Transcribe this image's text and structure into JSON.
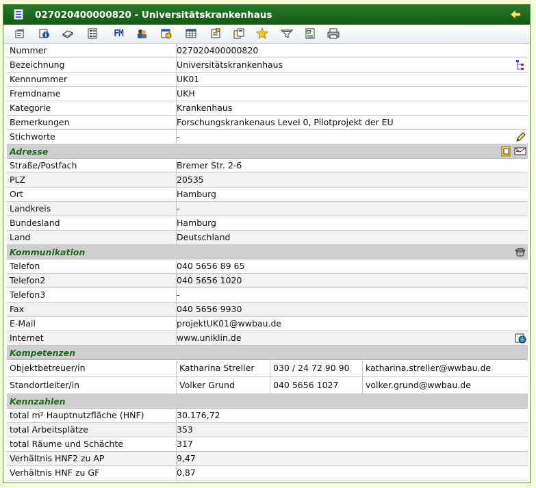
{
  "window": {
    "title": "027020400000820 - Universitätskrankenhaus"
  },
  "toolbar": {
    "buttons": [
      "properties-icon",
      "info-icon",
      "eraser-icon",
      "list-icon",
      "fm-icon",
      "users-icon",
      "calendar-icon",
      "table-icon",
      "notes-icon",
      "documents-icon",
      "favorite-star-icon",
      "filter-icon",
      "excel-export-icon",
      "print-icon"
    ],
    "fm_label": "FM"
  },
  "general": [
    {
      "label": "Nummer",
      "value": "027020400000820"
    },
    {
      "label": "Bezeichnung",
      "value": "Universitätskrankenhaus"
    },
    {
      "label": "Kennnummer",
      "value": "UK01"
    },
    {
      "label": "Fremdname",
      "value": "UKH"
    },
    {
      "label": "Kategorie",
      "value": "Krankenhaus"
    },
    {
      "label": "Bemerkungen",
      "value": "Forschungskrankenaus Level 0, Pilotprojekt der EU"
    },
    {
      "label": "Stichworte",
      "value": "-"
    }
  ],
  "sections": {
    "adresse": "Adresse",
    "kommunikation": "Kommunikation",
    "kompetenzen": "Kompetenzen",
    "kennzahlen": "Kennzahlen"
  },
  "adresse": [
    {
      "label": "Straße/Postfach",
      "value": "Bremer Str. 2-6"
    },
    {
      "label": "PLZ",
      "value": "20535"
    },
    {
      "label": "Ort",
      "value": "Hamburg"
    },
    {
      "label": "Landkreis",
      "value": "-"
    },
    {
      "label": "Bundesland",
      "value": "Hamburg"
    },
    {
      "label": "Land",
      "value": "Deutschland"
    }
  ],
  "kommunikation": [
    {
      "label": "Telefon",
      "value": "040 5656 89 65"
    },
    {
      "label": "Telefon2",
      "value": "040 5656 1020"
    },
    {
      "label": "Telefon3",
      "value": "-"
    },
    {
      "label": "Fax",
      "value": "040 5656 9930"
    },
    {
      "label": "E-Mail",
      "value": "projektUK01@wwbau.de"
    },
    {
      "label": "Internet",
      "value": "www.uniklin.de"
    }
  ],
  "kompetenzen": [
    {
      "label": "Objektbetreuer/in",
      "name": "Katharina Streller",
      "phone": "030 / 24 72 90 90",
      "email": "katharina.streller@wwbau.de"
    },
    {
      "label": "Standortleiter/in",
      "name": "Volker Grund",
      "phone": "040 5656 1027",
      "email": "volker.grund@wwbau.de"
    }
  ],
  "kennzahlen": [
    {
      "label": "total m² Hauptnutzfläche (HNF)",
      "value": "30.176,72"
    },
    {
      "label": "total Arbeitsplätze",
      "value": "353"
    },
    {
      "label": "total Räume und Schächte",
      "value": "317"
    },
    {
      "label": "Verhältnis HNF2 zu AP",
      "value": "9,47"
    },
    {
      "label": "Verhältnis HNF zu GF",
      "value": "0,87"
    }
  ],
  "colors": {
    "titlebar": "#1a6a1c",
    "section_title": "#1f6a1f",
    "section_bg": "#cfcfcf",
    "page_bg": "#f4ffd9"
  }
}
